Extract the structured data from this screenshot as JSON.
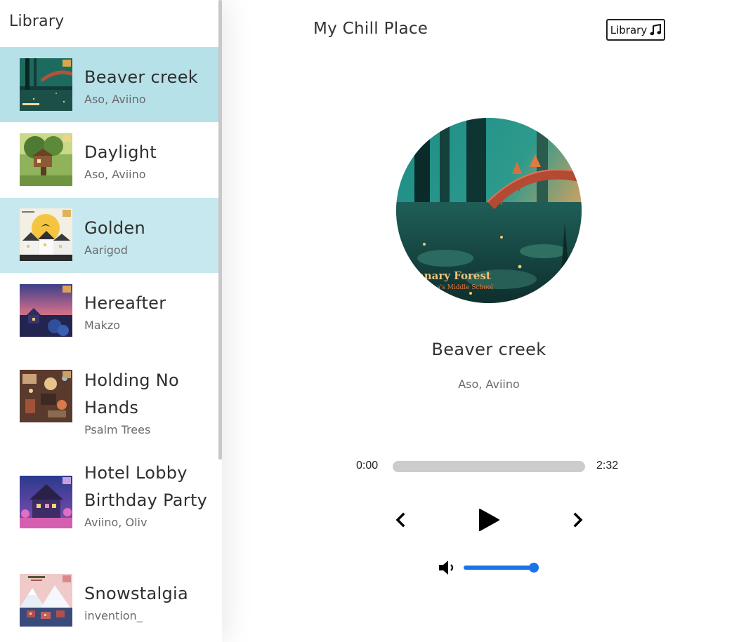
{
  "library": {
    "title": "Library",
    "songs": [
      {
        "name": "Beaver creek",
        "artist": "Aso, Aviino",
        "state": "selected",
        "cover": "forest-bridge-art"
      },
      {
        "name": "Daylight",
        "artist": "Aso, Aviino",
        "state": "normal",
        "cover": "treehouse-art"
      },
      {
        "name": "Golden",
        "artist": "Aarigod",
        "state": "hovered",
        "cover": "golden-houses-art"
      },
      {
        "name": "Hereafter",
        "artist": "Makzo",
        "state": "normal",
        "cover": "sunset-village-art"
      },
      {
        "name": "Holding No Hands",
        "artist": "Psalm Trees",
        "state": "normal",
        "cover": "cluttered-desk-art"
      },
      {
        "name": "Hotel Lobby Birthday Party",
        "artist": "Aviino, Oliv",
        "state": "normal",
        "cover": "purple-house-art"
      },
      {
        "name": "Snowstalgia",
        "artist": "invention_",
        "state": "normal",
        "cover": "snowy-town-art"
      }
    ]
  },
  "nav": {
    "title": "My Chill Place",
    "library_button_label": "Library",
    "library_button_icon": "music-note-icon"
  },
  "player": {
    "album_art": "forest-bridge-art",
    "album_art_text": [
      "anary Forest",
      "ibina's Middle School"
    ],
    "title": "Beaver creek",
    "artist": "Aso, Aviino",
    "current_time": "0:00",
    "duration": "2:32",
    "progress_fraction": 0,
    "volume_fraction": 1,
    "controls": {
      "prev_icon": "chevron-left-icon",
      "play_icon": "play-icon",
      "next_icon": "chevron-right-icon",
      "volume_icon": "volume-low-icon"
    }
  },
  "colors": {
    "selected_bg": "#b7e1e9",
    "hover_bg": "#c6e8ee",
    "volume_accent": "#1a73e8",
    "progress_track": "#cccccc"
  }
}
